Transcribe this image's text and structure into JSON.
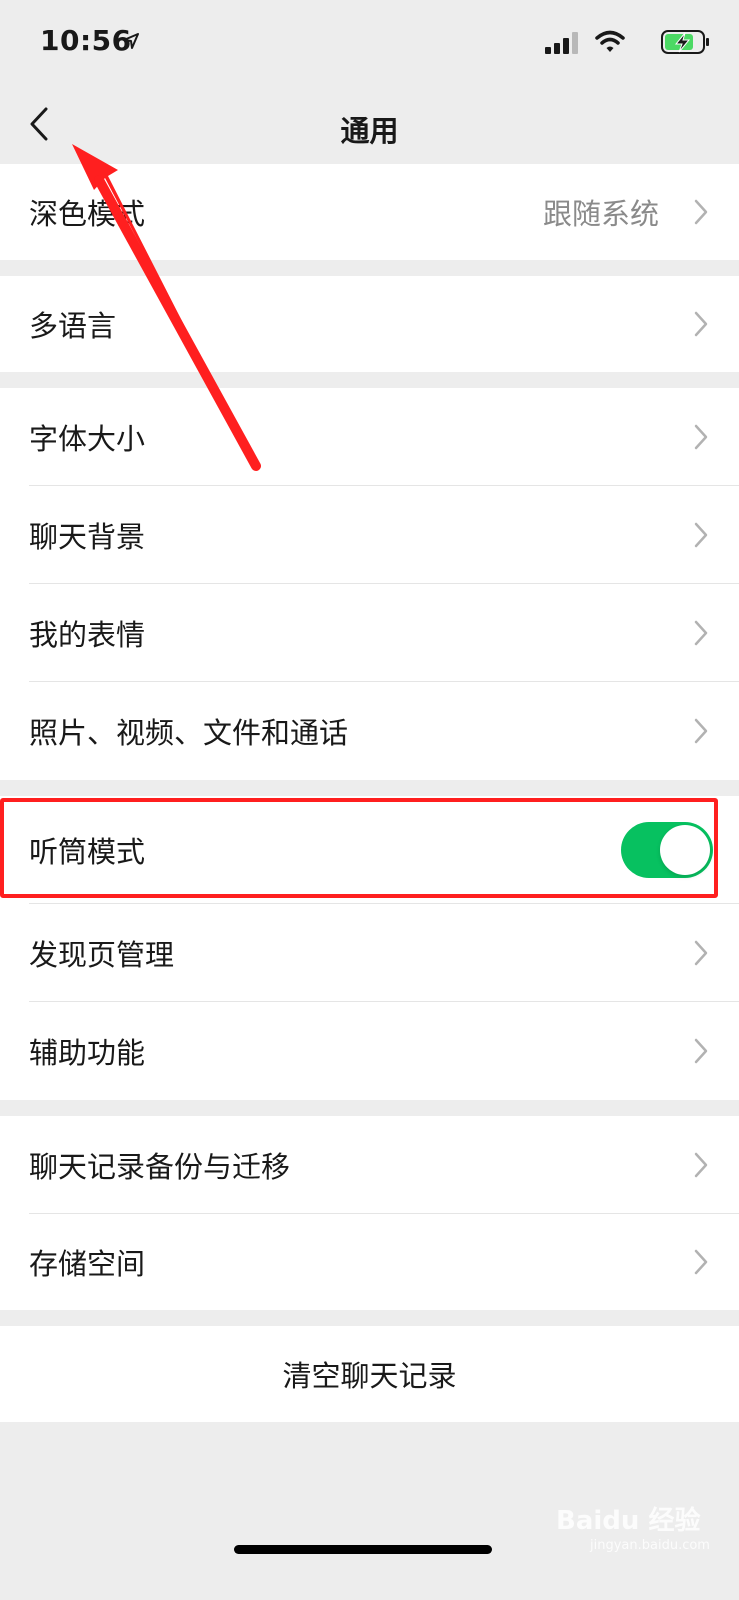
{
  "status_bar": {
    "time": "10:56",
    "icons": [
      "location-arrow-icon",
      "cellular-signal-icon",
      "wifi-icon",
      "battery-charging-icon"
    ]
  },
  "nav": {
    "title": "通用",
    "back_icon": "chevron-left-icon"
  },
  "groups": [
    {
      "items": [
        {
          "label": "深色模式",
          "value": "跟随系统"
        }
      ]
    },
    {
      "items": [
        {
          "label": "多语言"
        }
      ]
    },
    {
      "items": [
        {
          "label": "字体大小"
        },
        {
          "label": "聊天背景"
        },
        {
          "label": "我的表情"
        },
        {
          "label": "照片、视频、文件和通话"
        }
      ]
    },
    {
      "items": [
        {
          "label": "听筒模式",
          "toggle": true
        },
        {
          "label": "发现页管理"
        },
        {
          "label": "辅助功能"
        }
      ]
    },
    {
      "items": [
        {
          "label": "聊天记录备份与迁移"
        },
        {
          "label": "存储空间"
        }
      ]
    }
  ],
  "clear_button": "清空聊天记录",
  "watermark": {
    "brand": "Baidu 经验",
    "url": "jingyan.baidu.com"
  },
  "colors": {
    "background": "#ededed",
    "toggle_on": "#07c160",
    "annotation_red": "#ff1f1f"
  }
}
